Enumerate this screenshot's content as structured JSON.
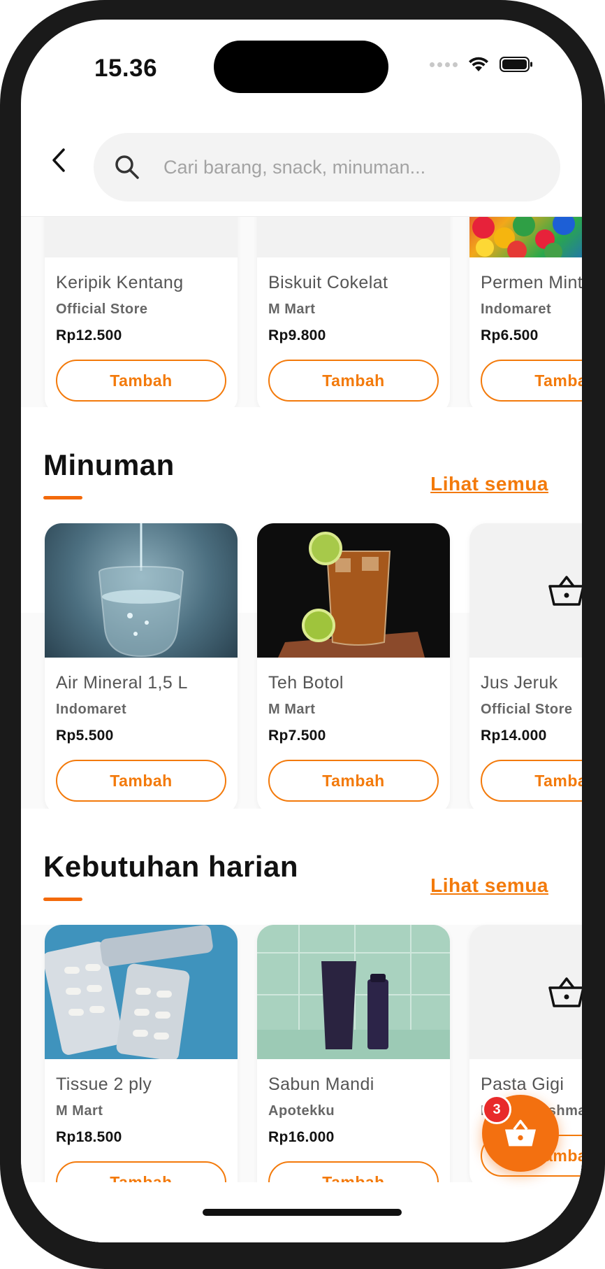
{
  "status_bar": {
    "time": "15.36"
  },
  "header": {
    "search_placeholder": "Cari barang, snack, minuman..."
  },
  "top_row": {
    "items": [
      {
        "name": "Keripik Kentang",
        "store": "Official Store",
        "price": "Rp12.500",
        "button": "Tambah"
      },
      {
        "name": "Biskuit Cokelat",
        "store": "M Mart",
        "price": "Rp9.800",
        "button": "Tambah"
      },
      {
        "name": "Permen Mint",
        "store": "Indomaret",
        "price": "Rp6.500",
        "button": "Tambah"
      }
    ]
  },
  "minuman": {
    "title": "Minuman",
    "see_all": "Lihat semua",
    "items": [
      {
        "name": "Air Mineral 1,5 L",
        "store": "Indomaret",
        "price": "Rp5.500",
        "button": "Tambah"
      },
      {
        "name": "Teh Botol",
        "store": "M Mart",
        "price": "Rp7.500",
        "button": "Tambah"
      },
      {
        "name": "Jus Jeruk",
        "store": "Official Store",
        "price": "Rp14.000",
        "button": "Tambah"
      }
    ]
  },
  "kebutuhan": {
    "title": "Kebutuhan harian",
    "see_all": "Lihat semua",
    "items": [
      {
        "name": "Tissue 2 ply",
        "store": "M Mart",
        "price": "Rp18.500",
        "button": "Tambah"
      },
      {
        "name": "Sabun Mandi",
        "store": "Apotekku",
        "price": "Rp16.000",
        "button": "Tambah"
      },
      {
        "name": "Pasta Gigi",
        "store": "Prima Freshmart",
        "price": "",
        "button": "Tambah"
      }
    ]
  },
  "cart": {
    "count": "3"
  },
  "colors": {
    "accent": "#f37a0b",
    "badge": "#e82a2a"
  }
}
